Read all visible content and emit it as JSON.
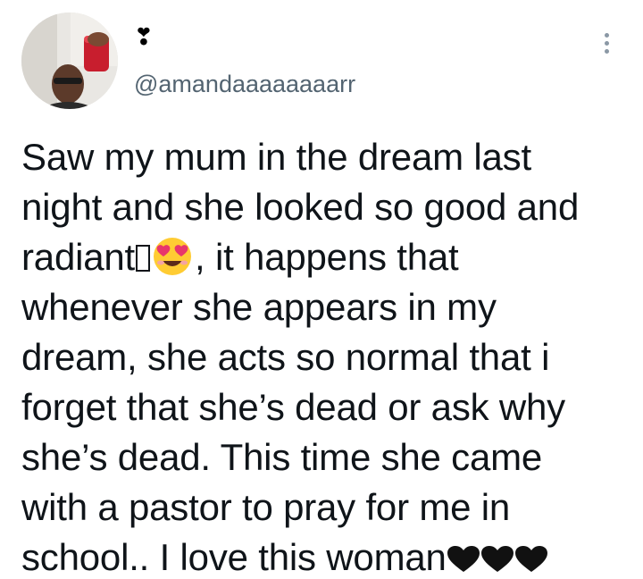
{
  "user": {
    "display_name": "❣",
    "handle": "@amandaaaaaaaarr"
  },
  "tweet": {
    "lines": [
      "Saw my mum in the dream last",
      "night and she looked so good and",
      "radiant",
      ", it happens that",
      "whenever she appears in my",
      "dream, she acts so normal that i",
      "forget that she’s dead or ask why",
      "she’s dead. This time she came",
      "with a pastor to pray for me in",
      "school.. I love this woman"
    ]
  },
  "icons": {
    "more": "more-vertical-icon",
    "emoji_face": "heart-eyes-emoji-icon",
    "heart": "black-heart-icon"
  },
  "colors": {
    "text": "#0f1419",
    "handle": "#536471",
    "more_dots": "#8b98a5"
  }
}
